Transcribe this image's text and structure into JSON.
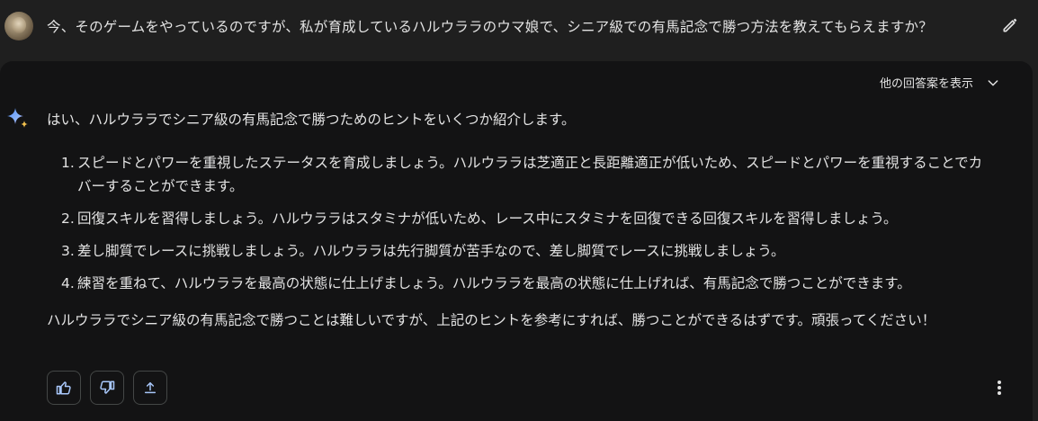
{
  "prompt": {
    "text": "今、そのゲームをやっているのですが、私が育成しているハルウララのウマ娘で、シニア級での有馬記念で勝つ方法を教えてもらえますか？"
  },
  "response": {
    "drafts_label": "他の回答案を表示",
    "intro": "はい、ハルウララでシニア級の有馬記念で勝つためのヒントをいくつか紹介します。",
    "tips": [
      {
        "num": "1.",
        "line1": "スピードとパワーを重視したステータスを育成しましょう。ハルウララは芝適正と長距離適正が低いため、スピードとパワーを重視することでカ",
        "line2": "バーすることができます。"
      },
      {
        "num": "2.",
        "line1": "回復スキルを習得しましょう。ハルウララはスタミナが低いため、レース中にスタミナを回復できる回復スキルを習得しましょう。"
      },
      {
        "num": "3.",
        "line1": "差し脚質でレースに挑戦しましょう。ハルウララは先行脚質が苦手なので、差し脚質でレースに挑戦しましょう。"
      },
      {
        "num": "4.",
        "line1": "練習を重ねて、ハルウララを最高の状態に仕上げましょう。ハルウララを最高の状態に仕上げれば、有馬記念で勝つことができます。"
      }
    ],
    "closing": "ハルウララでシニア級の有馬記念で勝つことは難しいですが、上記のヒントを参考にすれば、勝つことができるはずです。頑張ってください！"
  },
  "icons": {
    "edit": "pencil-icon",
    "gemini": "gemini-sparkle-icon",
    "chevron": "chevron-down-icon",
    "thumbs_up": "thumbs-up-icon",
    "thumbs_down": "thumbs-down-icon",
    "share": "share-icon",
    "more": "more-vert-icon"
  },
  "colors": {
    "background": "#1f1f1f",
    "card": "#131314",
    "text": "#e3e3e3",
    "button_border": "#444746",
    "action_icon": "#a8c7fa"
  }
}
